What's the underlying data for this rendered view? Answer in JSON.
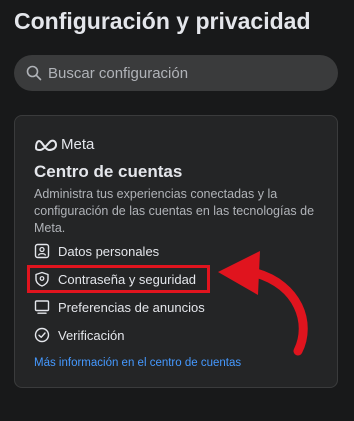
{
  "page": {
    "title": "Configuración y privacidad"
  },
  "search": {
    "placeholder": "Buscar configuración",
    "icon": "search-icon"
  },
  "card": {
    "brand": "Meta",
    "title": "Centro de cuentas",
    "description": "Administra tus experiencias conectadas y la configuración de las cuentas en las tecnologías de Meta.",
    "items": [
      {
        "label": "Datos personales",
        "icon": "id-card-icon"
      },
      {
        "label": "Contraseña y seguridad",
        "icon": "shield-icon"
      },
      {
        "label": "Preferencias de anuncios",
        "icon": "monitor-icon"
      },
      {
        "label": "Verificación",
        "icon": "verified-badge-icon"
      }
    ],
    "link": "Más información en el centro de cuentas"
  },
  "colors": {
    "background": "#18191a",
    "card": "#242526",
    "link": "#4599ff",
    "highlight": "#e0141e"
  }
}
